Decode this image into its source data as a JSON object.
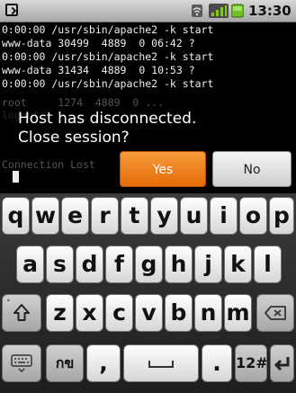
{
  "status_bar": {
    "time": "13:30"
  },
  "terminal": {
    "lines": [
      "0:00:00 /usr/sbin/apache2 -k start",
      "www-data 30499  4889  0 06:42 ?",
      "0:00:00 /usr/sbin/apache2 -k start",
      "www-data 31434  4889  0 10:53 ?",
      "0:00:00 /usr/sbin/apache2 -k start"
    ],
    "behind_dialog": [
      "root     1274  4889  0 ...",
      "logout"
    ],
    "partial_line": "Connection Lost"
  },
  "dialog": {
    "line1": "Host has disconnected.",
    "line2": "Close session?",
    "yes_label": "Yes",
    "no_label": "No"
  },
  "keyboard": {
    "row1": [
      "q",
      "w",
      "e",
      "r",
      "t",
      "y",
      "u",
      "i",
      "o",
      "p"
    ],
    "row2": [
      "a",
      "s",
      "d",
      "f",
      "g",
      "h",
      "j",
      "k",
      "l"
    ],
    "row3": [
      "z",
      "x",
      "c",
      "v",
      "b",
      "n",
      "m"
    ],
    "lang_label": "กข",
    "comma": ",",
    "period": ".",
    "symbols_label": "12#"
  }
}
